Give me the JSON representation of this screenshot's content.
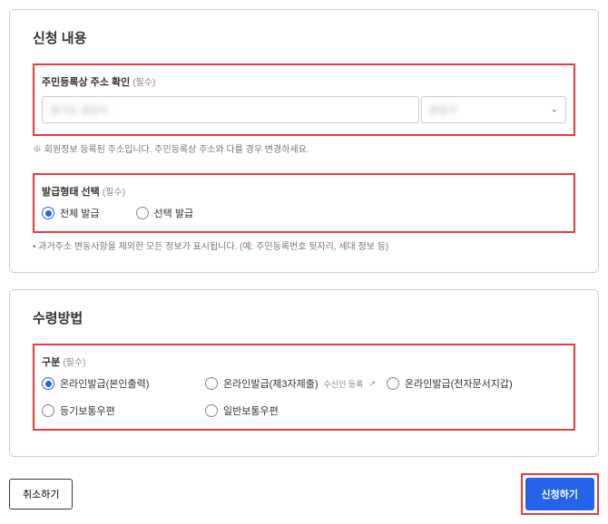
{
  "section1": {
    "title": "신청 내용",
    "address": {
      "label": "주민등록상 주소 확인",
      "required": "(필수)",
      "note": "※ 회원정보 등록된 주소입니다. 주민등록상 주소와 다를 경우 변경하세요.",
      "val1": "경기도 성남시",
      "val2": "분당구"
    },
    "issueType": {
      "label": "발급형태 선택",
      "required": "(필수)",
      "opt1": "전체 발급",
      "opt2": "선택 발급",
      "note": "• 과거주소 변동사항을 제외한 모든 정보가 표시됩니다. (예: 주민등록번호 뒷자리, 세대 정보 등)"
    }
  },
  "section2": {
    "title": "수령방법",
    "category": {
      "label": "구분",
      "required": "(필수)",
      "opt1": "온라인발급(본인출력)",
      "opt2": "온라인발급(제3자제출)",
      "opt2_sub": "수신인 등록",
      "opt3": "온라인발급(전자문서지갑)",
      "opt4": "등기보통우편",
      "opt5": "일반보통우편"
    }
  },
  "buttons": {
    "cancel": "취소하기",
    "submit": "신청하기"
  }
}
